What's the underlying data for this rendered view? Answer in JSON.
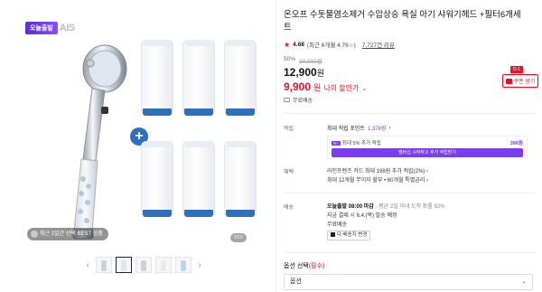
{
  "brand": {
    "badge": "오늘출발",
    "logo_text": "AIS"
  },
  "gallery": {
    "best_badge": "최근 2일간 선택 BEST 상품",
    "page_counter": "2/10",
    "prev_icon": "chevron-left-icon",
    "next_icon": "chevron-right-icon"
  },
  "product": {
    "title": "온오프 수돗물염소제거 수압상승 욕실 아기 샤워기헤드 +필터6개세트",
    "rating_star": "★",
    "rating_score": "4.68",
    "rating_detail": "(최근 6개월 4.76☆)",
    "review_link": "7,727건 리뷰",
    "discount_rate": "50%",
    "original_price": "20,000원",
    "price_value": "12,900",
    "price_unit": "원",
    "my_price_value": "9,900",
    "my_price_unit": "원",
    "my_price_label": "나의 할인가",
    "my_price_chevron": "⌄",
    "shipping": "무료배송",
    "coupon": {
      "dday": "D-1",
      "label": "쿠폰 받기"
    }
  },
  "benefits": {
    "label": "적립",
    "max_point_label": "최대 적립 포인트",
    "max_point_value": "1,378원",
    "chevron": "›",
    "box_tag": "N+",
    "box_text": "최대 5% 추가 적립",
    "box_amount": "396원",
    "box_button": "멤버십 시작하고 추가 적립받기"
  },
  "card": {
    "label": "혜택",
    "line1": "라인프렌즈 카드 최대 198원 추가 적립(2%) ›",
    "line2": "최대 12개월 무이자 할부 • 60개월 특별금리 ›"
  },
  "delivery": {
    "label": "배송",
    "line1_bold": "오늘출발 08:00 마감",
    "line1_sub": " · 평균 2일 이내 도착 확률 92%",
    "line2": "지금 결제 시 6.4.(목) 발송 예정",
    "line3": "무료배송",
    "kakao_label": "다 배송지 변경"
  },
  "option": {
    "label": "옵션 선택",
    "required": "(필수)",
    "select_value": "옵션",
    "chevron": "⌄"
  },
  "colors": {
    "accent_red": "#e4132b",
    "membership_purple": "#7a3cf0",
    "filter_cap_blue": "#2f6fbf"
  }
}
